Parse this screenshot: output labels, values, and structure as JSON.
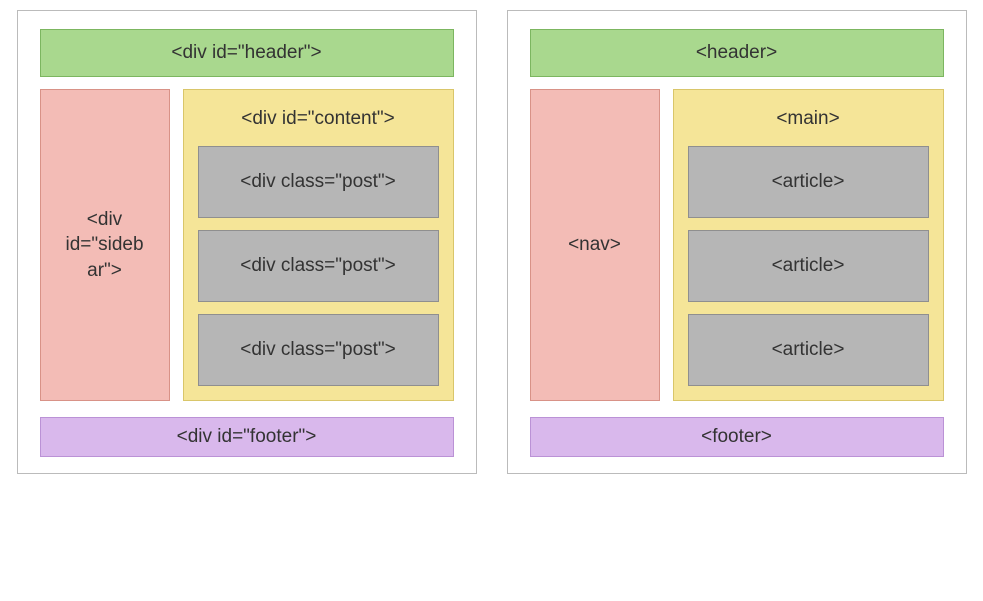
{
  "left": {
    "header": "<div id=\"header\">",
    "sidebar": "<div id=\"sideb ar\">",
    "content_title": "<div id=\"content\">",
    "posts": [
      "<div class=\"post\">",
      "<div class=\"post\">",
      "<div class=\"post\">"
    ],
    "footer": "<div id=\"footer\">"
  },
  "right": {
    "header": "<header>",
    "sidebar": "<nav>",
    "content_title": "<main>",
    "posts": [
      "<article>",
      "<article>",
      "<article>"
    ],
    "footer": "<footer>"
  }
}
